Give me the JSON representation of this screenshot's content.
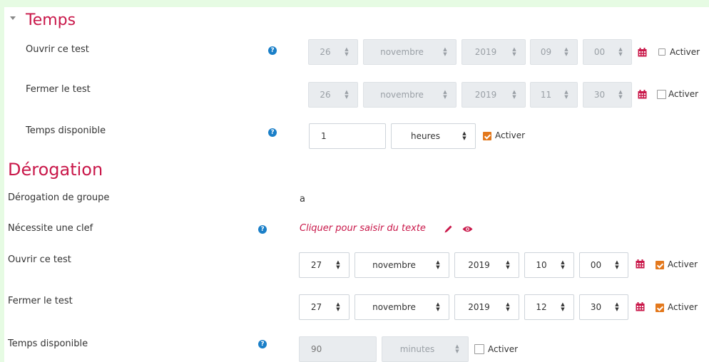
{
  "temps": {
    "heading": "Temps",
    "ouvrir": {
      "label": "Ouvrir ce test",
      "day": "26",
      "month": "novembre",
      "year": "2019",
      "hour": "09",
      "minute": "00",
      "enable_label": "Activer",
      "enabled": false
    },
    "fermer": {
      "label": "Fermer le test",
      "day": "26",
      "month": "novembre",
      "year": "2019",
      "hour": "11",
      "minute": "30",
      "enable_label": "Activer",
      "enabled": false
    },
    "disponible": {
      "label": "Temps disponible",
      "value": "1",
      "unit": "heures",
      "enable_label": "Activer",
      "enabled": true
    }
  },
  "derogation": {
    "heading": "Dérogation",
    "groupe": {
      "label": "Dérogation de groupe",
      "value": "a"
    },
    "clef": {
      "label": "Nécessite une clef",
      "link_text": "Cliquer pour saisir du texte"
    },
    "ouvrir": {
      "label": "Ouvrir ce test",
      "day": "27",
      "month": "novembre",
      "year": "2019",
      "hour": "10",
      "minute": "00",
      "enable_label": "Activer",
      "enabled": true
    },
    "fermer": {
      "label": "Fermer le test",
      "day": "27",
      "month": "novembre",
      "year": "2019",
      "hour": "12",
      "minute": "30",
      "enable_label": "Activer",
      "enabled": true
    },
    "disponible": {
      "label": "Temps disponible",
      "value": "90",
      "unit": "minutes",
      "enable_label": "Activer",
      "enabled": false
    }
  },
  "icons": {
    "help": "question-circle-icon",
    "calendar": "calendar-icon",
    "pencil": "pencil-icon",
    "eye": "eye-icon",
    "select_arrows": "sort-arrows-icon"
  },
  "colors": {
    "heading": "#c9184a",
    "checkbox_checked": "#e3781c",
    "help_icon": "#1a7fc8",
    "calendar_icon": "#c9184a",
    "page_background": "#e6fbe3"
  }
}
